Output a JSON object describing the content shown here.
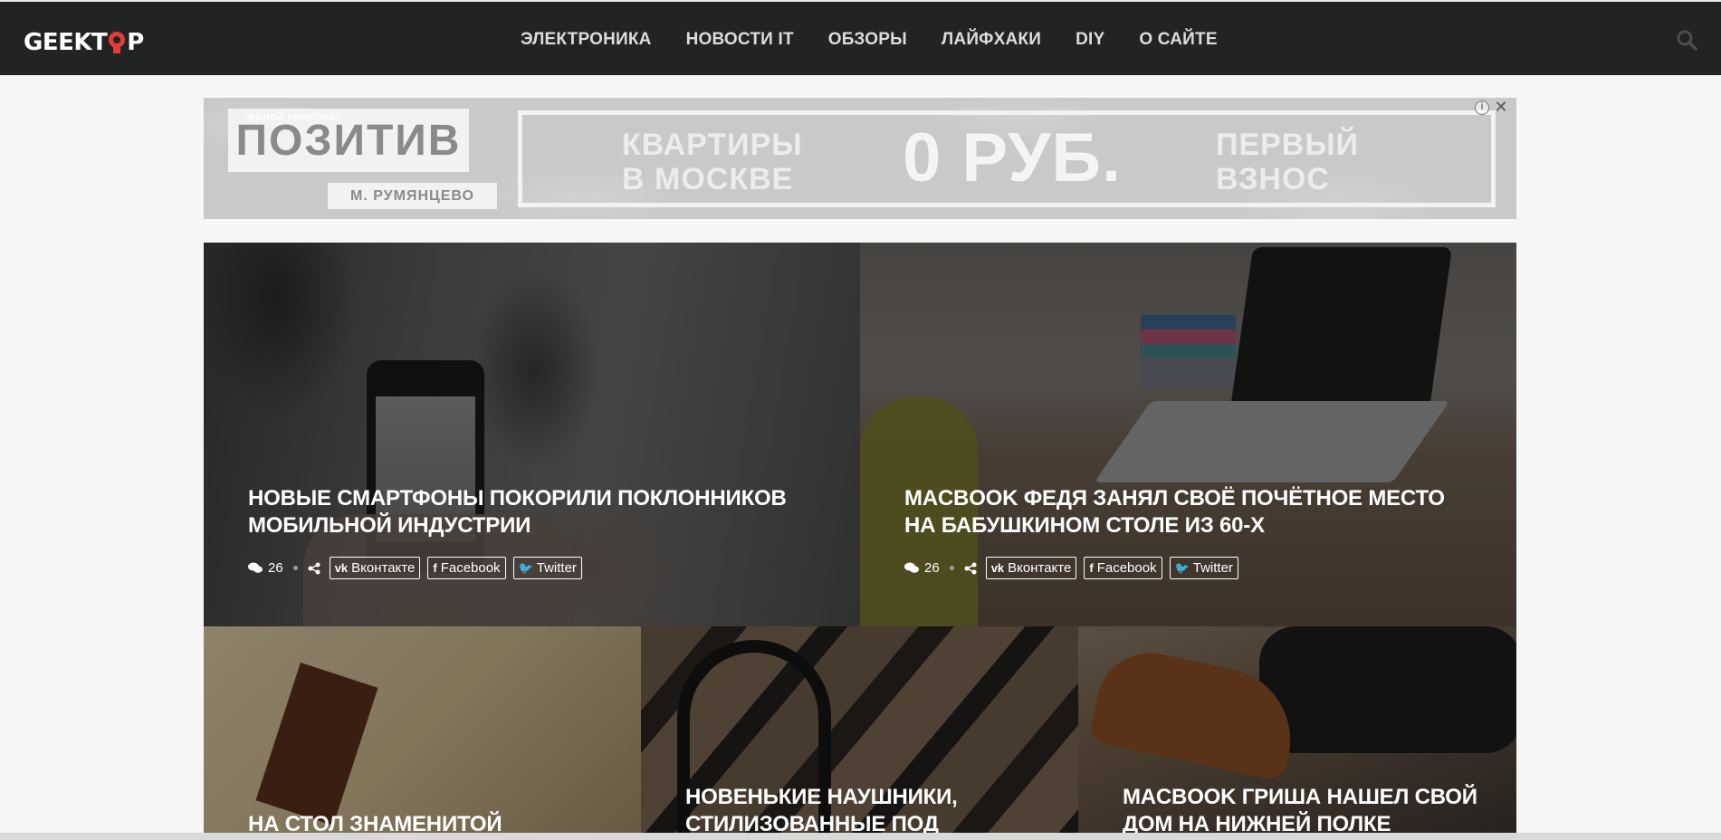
{
  "header": {
    "logo_left": "GEEKT",
    "logo_right": "P",
    "nav": [
      {
        "label": "ЭЛЕКТРОНИКА"
      },
      {
        "label": "НОВОСТИ IT"
      },
      {
        "label": "ОБЗОРЫ"
      },
      {
        "label": "ЛАЙФХАКИ"
      },
      {
        "label": "DIY"
      },
      {
        "label": "О САЙТЕ"
      }
    ]
  },
  "ad": {
    "brand_sub": "жилой комплекс",
    "brand_name": "ПОЗИТИВ",
    "brand_metro": "М. РУМЯНЦЕВО",
    "offer_left_1": "КВАРТИРЫ",
    "offer_left_2": "В МОСКВЕ",
    "offer_main": "0 РУБ.",
    "offer_right_1": "ПЕРВЫЙ",
    "offer_right_2": "ВЗНОС",
    "info_glyph": "i",
    "close_glyph": "✕"
  },
  "posts": [
    {
      "title": "Новые смартфоны покорили поклонников мобильной индустрии",
      "comments": "26",
      "share": {
        "vk": "Вконтакте",
        "fb": "Facebook",
        "tw": "Twitter"
      }
    },
    {
      "title": "Macbook Федя занял своё почётное место на бабушкином столе из 60-х",
      "comments": "26",
      "share": {
        "vk": "Вконтакте",
        "fb": "Facebook",
        "tw": "Twitter"
      }
    },
    {
      "title": "На стол знаменитой"
    },
    {
      "title": "Новенькие наушники, стилизованные под"
    },
    {
      "title": "Macbook Гриша нашел свой дом на нижней полке"
    }
  ],
  "colors": {
    "header_bg": "#222424",
    "accent": "#e33b3b",
    "page_bg": "#f6f6f6"
  },
  "icons": {
    "search": "search-icon",
    "comments": "comments-icon",
    "share": "share-icon",
    "vk": "vk-icon",
    "facebook": "facebook-icon",
    "twitter": "twitter-icon"
  }
}
